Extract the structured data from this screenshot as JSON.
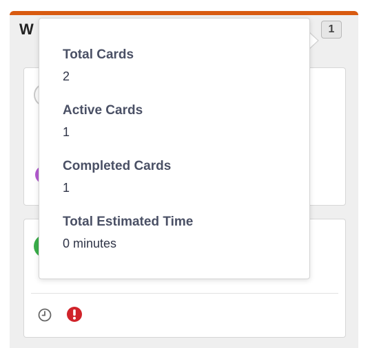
{
  "column": {
    "title": "W",
    "count": "1",
    "accent_color": "#d85a10"
  },
  "popover": {
    "stats": [
      {
        "label": "Total Cards",
        "value": "2"
      },
      {
        "label": "Active Cards",
        "value": "1"
      },
      {
        "label": "Completed Cards",
        "value": "1"
      },
      {
        "label": "Total Estimated Time",
        "value": "0 minutes"
      }
    ]
  },
  "cards": [
    {
      "status_icon": "empty-status-icon",
      "avatar_color": "#b35ad0"
    },
    {
      "avatar_color": "#3aae4a",
      "icons": [
        "clock-icon",
        "alert-icon"
      ],
      "alert_color": "#d0232a"
    }
  ]
}
